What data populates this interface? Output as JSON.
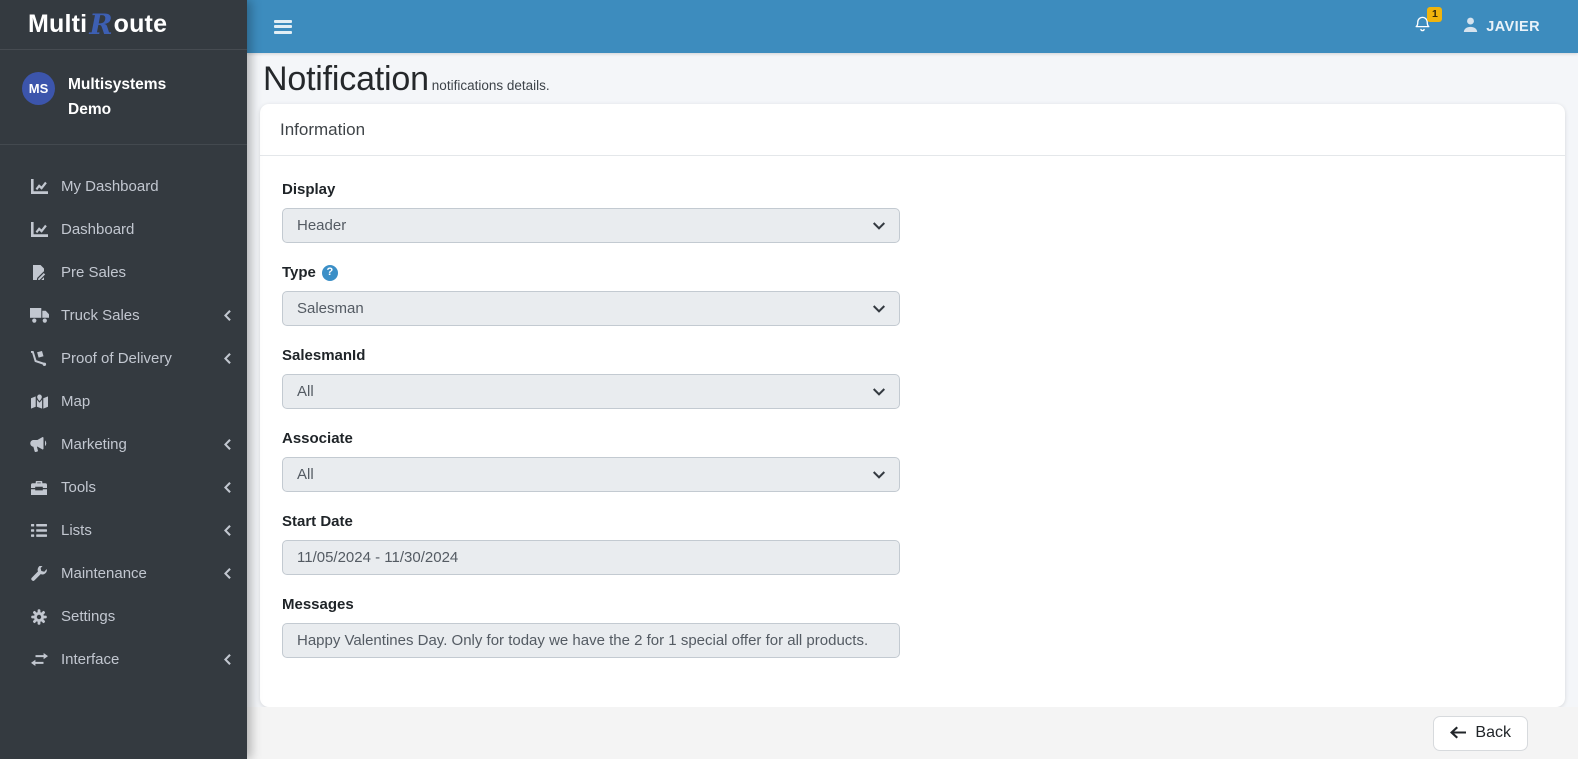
{
  "sidebar": {
    "brand": {
      "part1": "Multi",
      "part2": "R",
      "part3": "oute"
    },
    "user": {
      "initials": "MS",
      "name_line1": "Multisystems",
      "name_line2": "Demo"
    },
    "items": [
      {
        "label": "My Dashboard",
        "icon": "chart-line-icon",
        "has_submenu": false
      },
      {
        "label": "Dashboard",
        "icon": "chart-line-icon",
        "has_submenu": false
      },
      {
        "label": "Pre Sales",
        "icon": "file-pen-icon",
        "has_submenu": false
      },
      {
        "label": "Truck Sales",
        "icon": "truck-icon",
        "has_submenu": true
      },
      {
        "label": "Proof of Delivery",
        "icon": "dolly-icon",
        "has_submenu": true
      },
      {
        "label": "Map",
        "icon": "map-marked-icon",
        "has_submenu": false
      },
      {
        "label": "Marketing",
        "icon": "bullhorn-icon",
        "has_submenu": true
      },
      {
        "label": "Tools",
        "icon": "toolbox-icon",
        "has_submenu": true
      },
      {
        "label": "Lists",
        "icon": "list-icon",
        "has_submenu": true
      },
      {
        "label": "Maintenance",
        "icon": "wrench-icon",
        "has_submenu": true
      },
      {
        "label": "Settings",
        "icon": "gear-icon",
        "has_submenu": false
      },
      {
        "label": "Interface",
        "icon": "exchange-icon",
        "has_submenu": true
      }
    ]
  },
  "navbar": {
    "notification_count": "1",
    "username": "JAVIER"
  },
  "page": {
    "title": "Notification",
    "subtitle": "notifications details."
  },
  "card": {
    "title": "Information",
    "fields": [
      {
        "label": "Display",
        "value": "Header",
        "type": "select",
        "help": false
      },
      {
        "label": "Type",
        "value": "Salesman",
        "type": "select",
        "help": true,
        "help_glyph": "?"
      },
      {
        "label": "SalesmanId",
        "value": "All",
        "type": "select",
        "help": false
      },
      {
        "label": "Associate",
        "value": "All",
        "type": "select",
        "help": false
      },
      {
        "label": "Start Date",
        "value": "11/05/2024 - 11/30/2024",
        "type": "text",
        "help": false
      },
      {
        "label": "Messages",
        "value": "Happy Valentines Day. Only for today we have the 2 for 1 special offer for all products.",
        "type": "text",
        "help": false
      }
    ]
  },
  "footer": {
    "back_label": "Back"
  },
  "colors": {
    "navbar_bg": "#3d8cbe",
    "sidebar_bg": "#343a40",
    "sidebar_text": "#c2c7d0",
    "brand_r_blue": "#3d5fb3",
    "avatar_blue": "#3c55ac",
    "badge_yellow": "#f0b40d",
    "help_blue": "#3b8fc7",
    "input_bg": "#e9ecef",
    "input_border": "#c3cad1",
    "page_bg": "#f4f6f9",
    "footer_bg": "#f4f4f4"
  }
}
